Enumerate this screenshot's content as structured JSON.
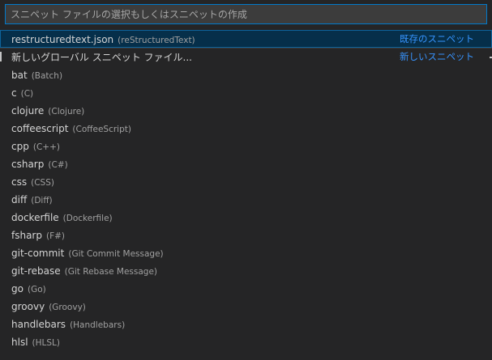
{
  "quick_pick": {
    "placeholder": "スニペット ファイルの選択もしくはスニペットの作成",
    "value": "",
    "items": [
      {
        "label": "restructuredtext.json",
        "description": "(reStructuredText)",
        "side": "既存のスニペット",
        "selected": true
      },
      {
        "label": "新しいグローバル スニペット ファイル...",
        "description": "",
        "side": "新しいスニペット"
      },
      {
        "label": "bat",
        "description": "(Batch)"
      },
      {
        "label": "c",
        "description": "(C)"
      },
      {
        "label": "clojure",
        "description": "(Clojure)"
      },
      {
        "label": "coffeescript",
        "description": "(CoffeeScript)"
      },
      {
        "label": "cpp",
        "description": "(C++)"
      },
      {
        "label": "csharp",
        "description": "(C#)"
      },
      {
        "label": "css",
        "description": "(CSS)"
      },
      {
        "label": "diff",
        "description": "(Diff)"
      },
      {
        "label": "dockerfile",
        "description": "(Dockerfile)"
      },
      {
        "label": "fsharp",
        "description": "(F#)"
      },
      {
        "label": "git-commit",
        "description": "(Git Commit Message)"
      },
      {
        "label": "git-rebase",
        "description": "(Git Rebase Message)"
      },
      {
        "label": "go",
        "description": "(Go)"
      },
      {
        "label": "groovy",
        "description": "(Groovy)"
      },
      {
        "label": "handlebars",
        "description": "(Handlebars)"
      },
      {
        "label": "hlsl",
        "description": "(HLSL)"
      }
    ]
  },
  "colors": {
    "background": "#252526",
    "input_background": "#3c3c3c",
    "focus_border": "#007acc",
    "selected_background": "#062f4a",
    "link": "#3794ff"
  }
}
